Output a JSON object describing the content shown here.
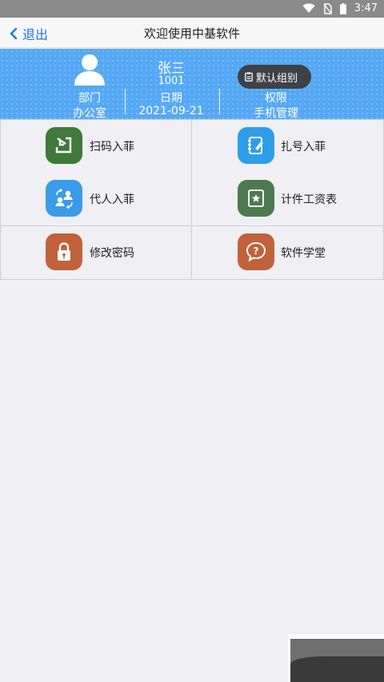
{
  "status_bar": {
    "time": "3:47",
    "icons": [
      "wifi-icon",
      "no-sim-icon",
      "battery-icon"
    ]
  },
  "nav": {
    "back_label": "退出",
    "title": "欢迎使用中基软件"
  },
  "profile": {
    "name": "张三",
    "id": "1001",
    "dept_label": "部门",
    "dept_value": "办公室",
    "date_label": "日期",
    "date_value": "2021-09-21",
    "perm_label": "权限",
    "perm_value": "手机管理",
    "group_button": "默认组别",
    "header_color": "#55a8f4"
  },
  "menu": {
    "rows": [
      [
        {
          "label": "扫码入菲",
          "icon": "scan-import-icon",
          "color": "#3f7a3a"
        },
        {
          "label": "扎号入菲",
          "icon": "notebook-icon",
          "color": "#2f9ee8"
        }
      ],
      [
        {
          "label": "代人入菲",
          "icon": "people-exchange-icon",
          "color": "#3a9be8"
        },
        {
          "label": "计件工资表",
          "icon": "star-badge-icon",
          "color": "#4c7a4e"
        }
      ],
      [
        {
          "label": "修改密码",
          "icon": "lock-icon",
          "color": "#c0623a"
        },
        {
          "label": "软件学堂",
          "icon": "question-bubble-icon",
          "color": "#c0623a"
        }
      ]
    ]
  }
}
